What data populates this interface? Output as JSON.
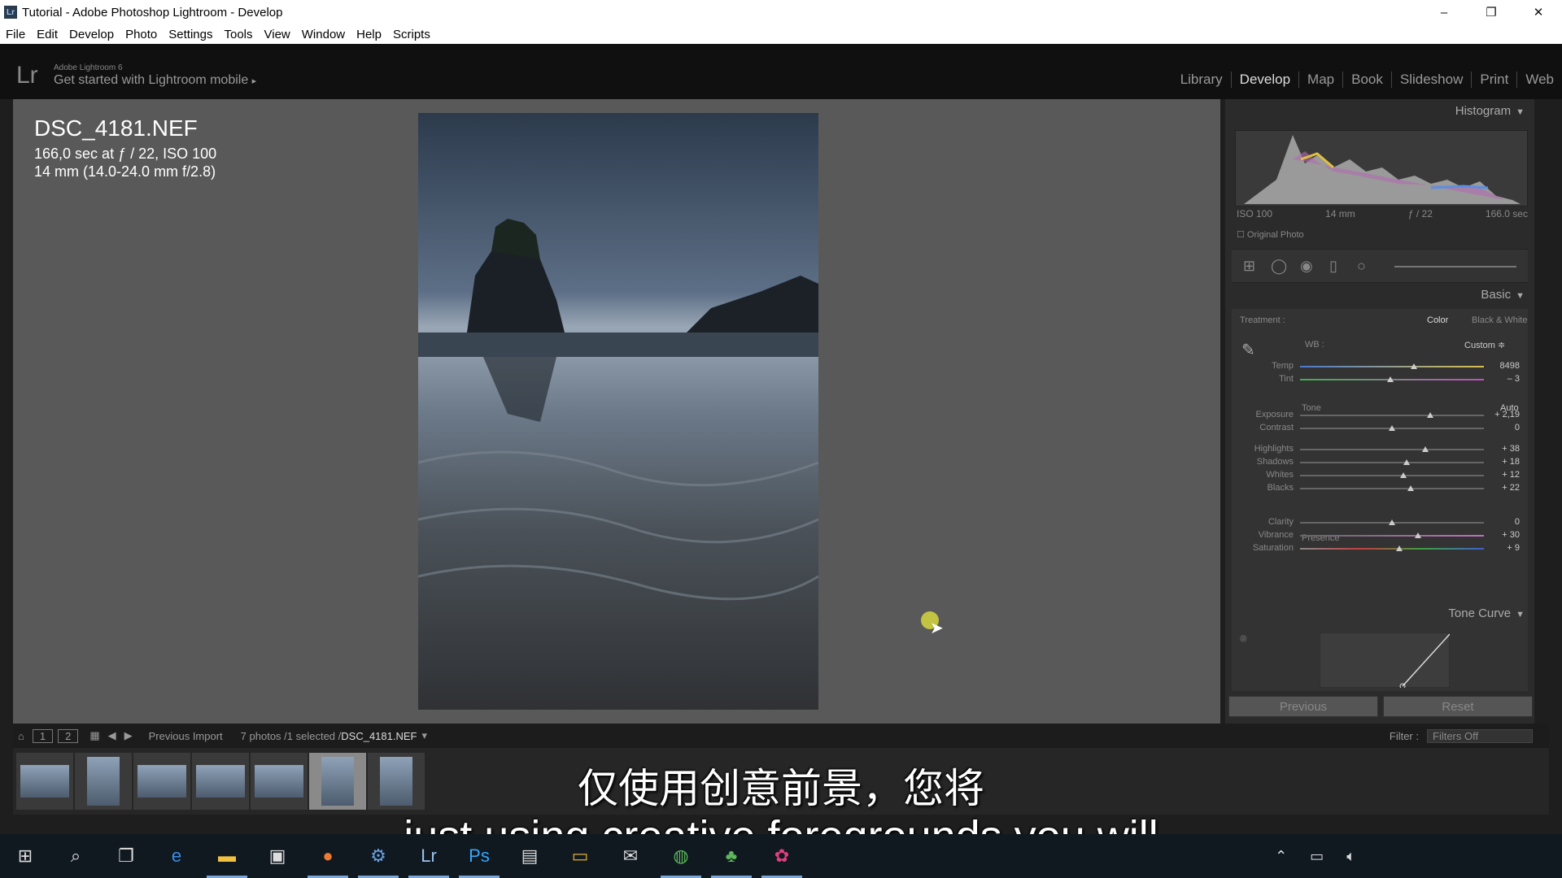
{
  "window": {
    "title": "Tutorial - Adobe Photoshop Lightroom - Develop",
    "app_icon": "Lr",
    "minimize": "–",
    "maximize": "❐",
    "close": "✕"
  },
  "menu": [
    "File",
    "Edit",
    "Develop",
    "Photo",
    "Settings",
    "Tools",
    "View",
    "Window",
    "Help",
    "Scripts"
  ],
  "header": {
    "logo": "Lr",
    "product": "Adobe Lightroom 6",
    "mobile_prompt": "Get started with Lightroom mobile",
    "mobile_arrow": "▸",
    "modules": [
      "Library",
      "Develop",
      "Map",
      "Book",
      "Slideshow",
      "Print",
      "Web"
    ],
    "active_module": "Develop"
  },
  "photo_info": {
    "filename": "DSC_4181.NEF",
    "exposure": "166,0 sec at ƒ / 22, ISO 100",
    "lens": "14 mm (14.0-24.0 mm f/2.8)"
  },
  "histogram": {
    "title": "Histogram",
    "iso": "ISO 100",
    "focal": "14 mm",
    "aperture": "ƒ / 22",
    "shutter": "166.0 sec",
    "original_photo": "Original Photo"
  },
  "basic": {
    "title": "Basic",
    "treatment_label": "Treatment :",
    "treatment_color": "Color",
    "treatment_bw": "Black & White",
    "wb_label": "WB :",
    "wb_value": "Custom ≑",
    "tone_label": "Tone",
    "auto_label": "Auto",
    "presence_label": "Presence",
    "sliders": [
      {
        "label": "Temp",
        "value": "8498",
        "pos": 0.62
      },
      {
        "label": "Tint",
        "value": "– 3",
        "pos": 0.49
      },
      {
        "label": "Exposure",
        "value": "+ 2,19",
        "pos": 0.71
      },
      {
        "label": "Contrast",
        "value": "0",
        "pos": 0.5
      },
      {
        "label": "Highlights",
        "value": "+ 38",
        "pos": 0.68
      },
      {
        "label": "Shadows",
        "value": "+ 18",
        "pos": 0.58
      },
      {
        "label": "Whites",
        "value": "+ 12",
        "pos": 0.56
      },
      {
        "label": "Blacks",
        "value": "+ 22",
        "pos": 0.6
      },
      {
        "label": "Clarity",
        "value": "0",
        "pos": 0.5
      },
      {
        "label": "Vibrance",
        "value": "+ 30",
        "pos": 0.64
      },
      {
        "label": "Saturation",
        "value": "+ 9",
        "pos": 0.54
      }
    ]
  },
  "tone_curve": {
    "title": "Tone Curve"
  },
  "buttons": {
    "previous": "Previous",
    "reset": "Reset"
  },
  "filmstrip_bar": {
    "page1": "1",
    "page2": "2",
    "source": "Previous Import",
    "count": "7 photos /1 selected /",
    "selected_file": "DSC_4181.NEF",
    "filter_label": "Filter :",
    "filter_value": "Filters Off"
  },
  "subtitles": {
    "chinese": "仅使用创意前景，您将",
    "english": "just using creative foregrounds you will"
  },
  "taskbar": {
    "icons": [
      "windows-start-icon",
      "search-icon",
      "task-view-icon",
      "edge-icon",
      "file-explorer-icon",
      "store-icon",
      "firefox-icon",
      "settings-app-icon",
      "lightroom-icon",
      "photoshop-icon",
      "files-icon",
      "folder-icon",
      "mail-icon",
      "globe-icon",
      "evernote-icon",
      "picasa-icon"
    ]
  }
}
